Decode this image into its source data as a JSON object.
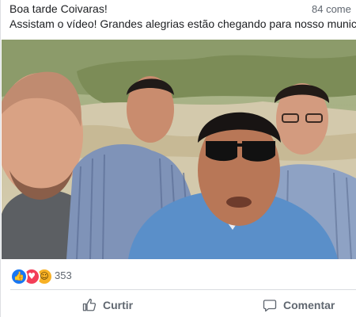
{
  "post": {
    "line1": "Boa tarde Coivaras!",
    "line2": "Assistam o vídeo! Grandes alegrias estão chegando para nosso municí"
  },
  "reactions": {
    "icons": [
      "like-icon",
      "love-icon",
      "haha-icon"
    ],
    "count": "353"
  },
  "comments": {
    "count_label": "84 come"
  },
  "actions": {
    "like_label": "Curtir",
    "comment_label": "Comentar"
  },
  "colors": {
    "like_blue": "#1877f2",
    "love_red": "#f33e58",
    "haha_yellow": "#f7b125",
    "muted_text": "#606770"
  }
}
